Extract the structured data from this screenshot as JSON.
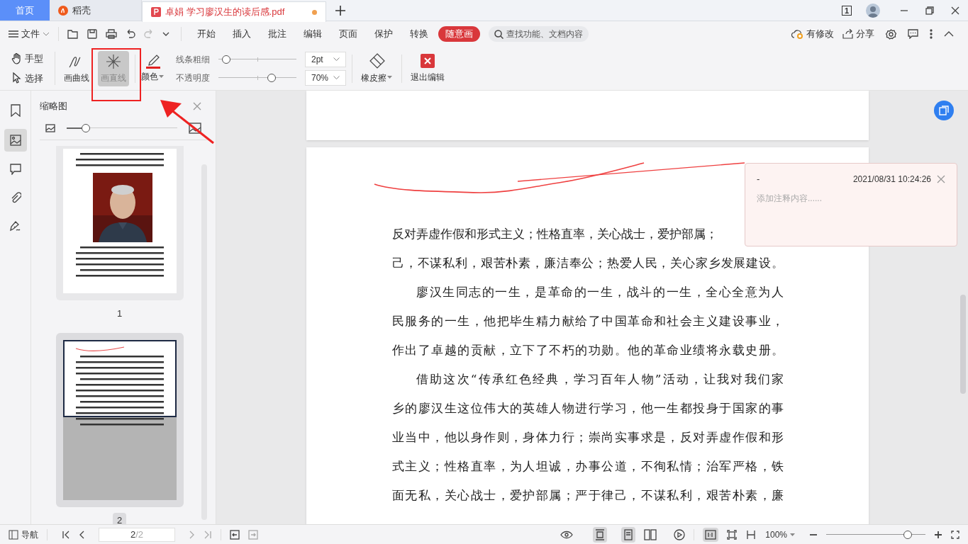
{
  "tabs": [
    {
      "kind": "home",
      "label": "首页",
      "selected": false
    },
    {
      "kind": "app",
      "label": "稻壳",
      "selected": false
    },
    {
      "kind": "doc",
      "label": "卓娟 学习廖汉生的读后感.pdf",
      "selected": true,
      "modified": true
    }
  ],
  "window_badge": "1",
  "menu": {
    "file": "文件",
    "ribbon": [
      {
        "label": "开始",
        "selected": false
      },
      {
        "label": "插入",
        "selected": false
      },
      {
        "label": "批注",
        "selected": false
      },
      {
        "label": "编辑",
        "selected": false
      },
      {
        "label": "页面",
        "selected": false
      },
      {
        "label": "保护",
        "selected": false
      },
      {
        "label": "转换",
        "selected": false
      },
      {
        "label": "随意画",
        "selected": true
      }
    ],
    "search_placeholder": "查找功能、文档内容",
    "sync": "有修改",
    "share": "分享"
  },
  "tools": {
    "hand": "手型",
    "select": "选择",
    "curve": {
      "label": "画曲线",
      "selected": false
    },
    "line": {
      "label": "画直线",
      "selected": true
    },
    "color": {
      "label": "颜色",
      "color": "#e02020"
    },
    "width": {
      "label": "线条粗细",
      "level": 0.05,
      "value": "2pt"
    },
    "opacity": {
      "label": "不透明度",
      "level": 0.7,
      "value": "70%"
    },
    "eraser": "橡皮擦",
    "exit": "退出编辑"
  },
  "sidebar": {
    "title": "缩略图",
    "zoom": {
      "level": 0.17
    },
    "thumbnails": [
      {
        "label": "1",
        "selected": false
      },
      {
        "label": "2",
        "selected": true
      }
    ]
  },
  "document": {
    "lines": [
      {
        "kind": "line",
        "text": "反对弄虚作假和形式主义；性格直率，关心战士，爱护部属；"
      },
      {
        "kind": "line",
        "text": "己，不谋私利，艰苦朴素，廉洁奉公；热爱人民，关心家乡发展建设。"
      },
      {
        "kind": "indent",
        "text": "廖汉生同志的一生，是革命的一生，战斗的一生，全心全意为人"
      },
      {
        "kind": "line",
        "text": "民服务的一生，他把毕生精力献给了中国革命和社会主义建设事业，"
      },
      {
        "kind": "last",
        "text": "作出了卓越的贡献，立下了不朽的功勋。他的革命业绩将永载史册。"
      },
      {
        "kind": "indent",
        "text": "借助这次“传承红色经典，学习百年人物”活动，让我对我们家"
      },
      {
        "kind": "line",
        "text": "乡的廖汉生这位伟大的英雄人物进行学习，他一生都投身于国家的事"
      },
      {
        "kind": "line",
        "text": "业当中，他以身作则，身体力行；崇尚实事求是，反对弄虚作假和形"
      },
      {
        "kind": "line",
        "text": "式主义；性格直率，为人坦诚，办事公道，不徇私情；治军严格，铁"
      },
      {
        "kind": "line",
        "text": "面无私，关心战士，爱护部属；严于律己，不谋私利，艰苦朴素，廉"
      }
    ]
  },
  "comment": {
    "author": "-",
    "time": "2021/08/31 10:24:26",
    "placeholder": "添加注释内容......"
  },
  "status_bar": {
    "nav": "导航",
    "page": "2",
    "total": "/2",
    "zoom": "100%",
    "zoom_slider": {
      "level": 0.82
    }
  }
}
